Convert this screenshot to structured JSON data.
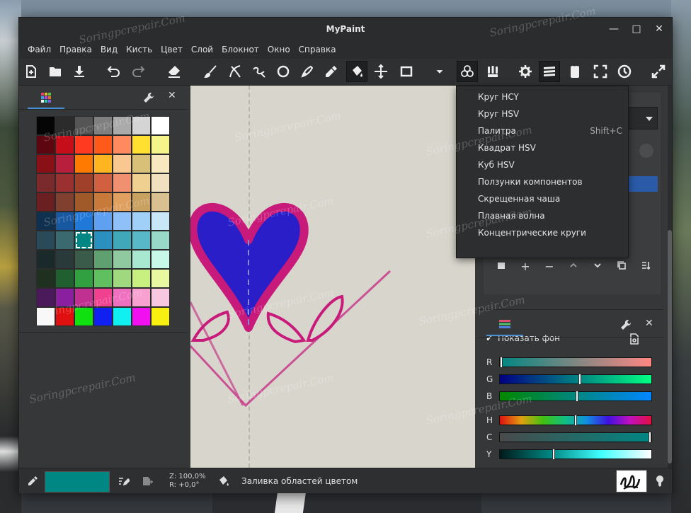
{
  "app": {
    "title": "MyPaint"
  },
  "window_buttons": {
    "minimize": "—",
    "maximize": "□",
    "close": "✕"
  },
  "menu": [
    "Файл",
    "Правка",
    "Вид",
    "Кисть",
    "Цвет",
    "Слой",
    "Блокнот",
    "Окно",
    "Справка"
  ],
  "toolbar": {
    "icons": [
      "new-document-icon",
      "open-folder-icon",
      "save-icon",
      "undo-icon",
      "redo-icon",
      "eraser-icon",
      "brush-icon",
      "inking-icon",
      "freehand-icon",
      "ellipse-icon",
      "pen-icon",
      "color-picker-icon",
      "fill-bucket-icon",
      "move-layer-icon",
      "frame-icon",
      "color-wheel-menu-icon",
      "brush-group-icon",
      "settings-icon",
      "layers-icon",
      "scratchpad-icon",
      "fullscreen-icon",
      "history-icon",
      "expand-icon"
    ]
  },
  "palette": {
    "colors": [
      "#050505",
      "#2b2b2b",
      "#555555",
      "#808080",
      "#aaaaaa",
      "#d4d4d4",
      "#ffffff",
      "#5c0710",
      "#c50e1a",
      "#ff3a20",
      "#ff5a1a",
      "#ff8a60",
      "#ffdf30",
      "#f4f48a",
      "#8a1018",
      "#b81f3c",
      "#ff7a00",
      "#ffb520",
      "#f8c890",
      "#d8c078",
      "#f8e8c0",
      "#7a2a2a",
      "#9a3030",
      "#a0402a",
      "#d06040",
      "#f09070",
      "#f0d090",
      "#f0e0c0",
      "#6a2020",
      "#804030",
      "#a05a2a",
      "#c87a3a",
      "#e0a060",
      "#c8a060",
      "#d8c090",
      "#103050",
      "#1858a0",
      "#2078d8",
      "#60a0f0",
      "#90c0f8",
      "#a0d0f8",
      "#c8e8f8",
      "#2a4a5a",
      "#3a6a70",
      "#008783",
      "#2a90c0",
      "#40a8b8",
      "#58b8c8",
      "#98d8c8",
      "#1a2a2a",
      "#2a3a3a",
      "#3a5a4a",
      "#60a070",
      "#90c8a0",
      "#a8e8d0",
      "#c8f8e8",
      "#203020",
      "#206030",
      "#30a040",
      "#60c060",
      "#a0d880",
      "#c8f080",
      "#e8f8a0",
      "#4a1a5a",
      "#8a20a0",
      "#c03090",
      "#f04090",
      "#f070c0",
      "#f8a0d0",
      "#f8c8e0",
      "#f8f8f8",
      "#e01010",
      "#10e010",
      "#1020f0",
      "#10f0f0",
      "#f010f0",
      "#f8f010"
    ],
    "selected_index": 44
  },
  "dropdown": {
    "items": [
      {
        "label": "Круг HCY",
        "accel": ""
      },
      {
        "label": "Круг HSV",
        "accel": ""
      },
      {
        "label": "Палитра",
        "accel": "Shift+C"
      },
      {
        "label": "Квадрат HSV",
        "accel": ""
      },
      {
        "label": "Куб HSV",
        "accel": ""
      },
      {
        "label": "Ползунки компонентов",
        "accel": ""
      },
      {
        "label": "Скрещенная чаша",
        "accel": ""
      },
      {
        "label": "Плавная волна",
        "accel": ""
      },
      {
        "label": "Концентрические круги",
        "accel": ""
      }
    ]
  },
  "layers": {
    "show_background_label": "Показать фон",
    "show_background_checked": true
  },
  "sliders": {
    "rows": [
      {
        "label": "R",
        "value": 0.0
      },
      {
        "label": "G",
        "value": 0.53
      },
      {
        "label": "B",
        "value": 0.51
      },
      {
        "label": "H",
        "value": 0.5
      },
      {
        "label": "C",
        "value": 1.0
      },
      {
        "label": "Y",
        "value": 0.35
      }
    ]
  },
  "status": {
    "current_color": "#008783",
    "zoom_line": "Z: 100,0%",
    "rotation_line": "R: +0,0°",
    "message": "Заливка областей цветом"
  },
  "watermark": "Soringpcrepair.Com"
}
